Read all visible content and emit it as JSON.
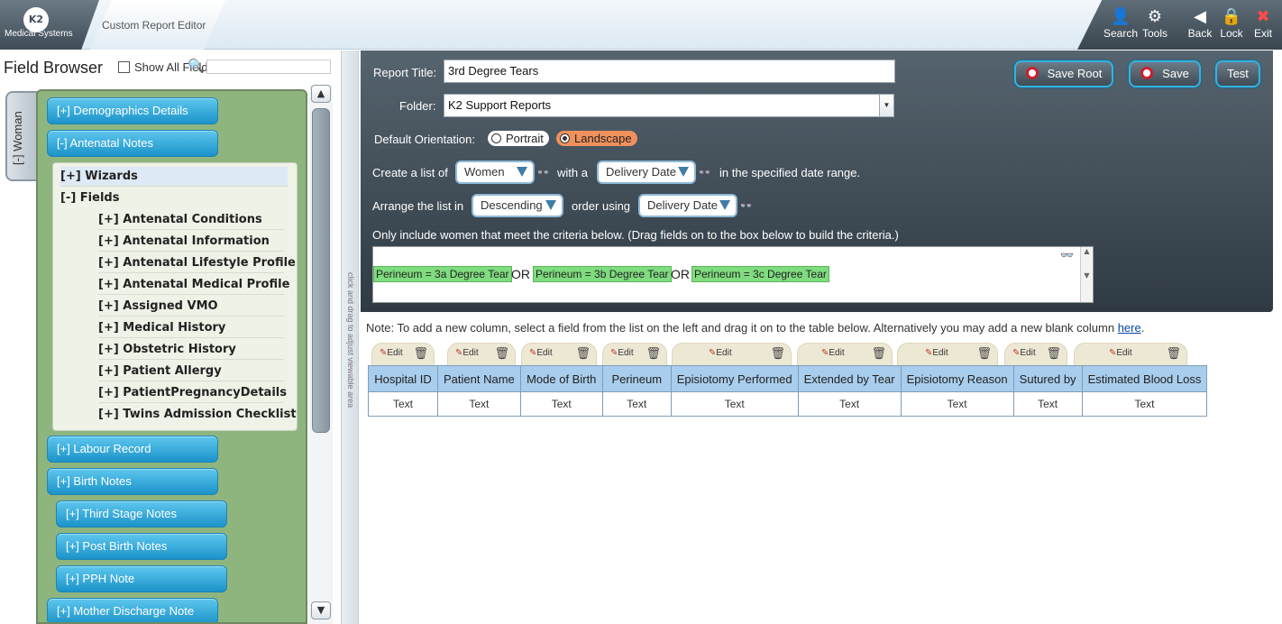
{
  "topbar": {
    "logo_mark": "K2",
    "logo_text": "Medical Systems",
    "tab_title": "Custom Report Editor",
    "tools": [
      {
        "label": "Search",
        "icon": "search-person-icon"
      },
      {
        "label": "Tools",
        "icon": "gear-icon"
      },
      {
        "label": "Back",
        "icon": "back-arrow-icon"
      },
      {
        "label": "Lock",
        "icon": "lock-icon"
      },
      {
        "label": "Exit",
        "icon": "close-icon"
      }
    ]
  },
  "field_browser": {
    "title": "Field Browser",
    "show_all_label": "Show All Fields",
    "search_value": "",
    "woman_tab": "[-] Woman",
    "divider_hint": "click and drag to adjust viewable area",
    "sections": [
      {
        "label": "[+] Demographics Details"
      },
      {
        "label": "[-] Antenatal Notes"
      }
    ],
    "subtree": {
      "wizards": "[+] Wizards",
      "fields": "[-] Fields",
      "items": [
        "[+] Antenatal Conditions",
        "[+] Antenatal Information",
        "[+] Antenatal Lifestyle Profile",
        "[+] Antenatal Medical Profile",
        "[+] Assigned VMO",
        "[+] Medical History",
        "[+] Obstetric History",
        "[+] Patient Allergy",
        "[+] PatientPregnancyDetails",
        "[+] Twins Admission Checklist"
      ]
    },
    "more_sections": [
      "[+] Labour Record",
      "[+] Birth Notes",
      "[+] Third Stage Notes",
      "[+] Post Birth Notes",
      "[+] PPH Note",
      "[+] Mother Discharge Note"
    ]
  },
  "report": {
    "title_label": "Report Title:",
    "title_value": "3rd Degree Tears",
    "folder_label": "Folder:",
    "folder_value": "K2 Support Reports",
    "orientation_label": "Default Orientation:",
    "orientation_options": [
      "Portrait",
      "Landscape"
    ],
    "orientation_selected": "Landscape",
    "create_prefix": "Create a list of",
    "create_subject": "Women",
    "create_with": "with a",
    "create_date_field": "Delivery Date",
    "create_suffix": "in the specified date range.",
    "arrange_prefix": "Arrange the list in",
    "arrange_order": "Descending",
    "arrange_using": "order using",
    "arrange_field": "Delivery Date",
    "criteria_instruction": "Only include women that meet the criteria below. (Drag fields on to the box below to build the criteria.)",
    "criteria": [
      "Perineum = 3a Degree Tear",
      "Perineum = 3b Degree Tear",
      "Perineum = 3c Degree Tear"
    ],
    "criteria_joiner": "OR",
    "buttons": {
      "save_root": "Save Root",
      "save": "Save",
      "test": "Test"
    }
  },
  "columns": {
    "note": "Note: To add a new column, select a field from the list on the left and drag it on to the table below. Alternatively you may add a new blank column",
    "note_link": "here",
    "note_end": ".",
    "edit_label": "Edit",
    "headers": [
      "Hospital ID",
      "Patient Name",
      "Mode of Birth",
      "Perineum",
      "Episiotomy Performed",
      "Extended by Tear",
      "Episiotomy Reason",
      "Sutured by",
      "Estimated Blood Loss"
    ],
    "types": [
      "Text",
      "Text",
      "Text",
      "Text",
      "Text",
      "Text",
      "Text",
      "Text",
      "Text"
    ]
  }
}
